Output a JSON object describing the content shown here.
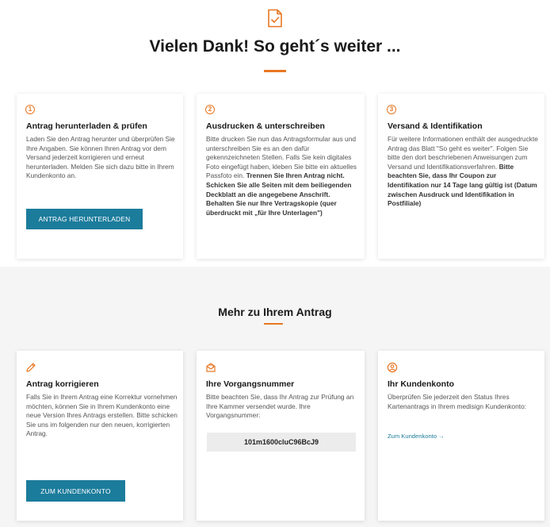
{
  "header": {
    "icon": "document-check-icon",
    "title": "Vielen Dank! So geht´s weiter ..."
  },
  "steps": [
    {
      "number": "1",
      "title": "Antrag herunterladen & prüfen",
      "text": "Laden Sie den Antrag herunter und überprüfen Sie Ihre Angaben. Sie können Ihren Antrag vor dem Versand jederzeit korrigieren und erneut herunterladen. Melden Sie sich dazu bitte in Ihrem Kundenkonto an.",
      "button": "ANTRAG HERUNTERLADEN"
    },
    {
      "number": "2",
      "title": "Ausdrucken & unterschreiben",
      "text": "Bitte drucken Sie nun das Antragsformular aus und unterschreiben Sie es an den dafür gekennzeichneten Stellen. Falls Sie kein digitales Foto eingefügt haben, kleben Sie bitte ein aktuelles Passfoto ein.",
      "bold": "Trennen Sie Ihren Antrag nicht. Schicken Sie alle Seiten mit dem beiliegenden Deckblatt an die angegebene Anschrift. Behalten Sie nur Ihre Vertragskopie (quer überdruckt mit „für Ihre Unterlagen\")"
    },
    {
      "number": "3",
      "title": "Versand & Identifikation",
      "text": "Für weitere Informationen enthält der ausgedruckte Antrag das Blatt \"So geht es weiter\". Folgen Sie bitte den dort beschriebenen Anweisungen zum Versand und Identifikationsverfahren.",
      "bold": "Bitte beachten Sie, dass Ihr Coupon zur Identifikation nur 14 Tage lang gültig ist (Datum zwischen Ausdruck und Identifikation in Postfiliale)"
    }
  ],
  "more": {
    "title": "Mehr zu Ihrem Antrag",
    "cards": [
      {
        "icon": "pencil-icon",
        "title": "Antrag korrigieren",
        "text": "Falls Sie in Ihrem Antrag eine Korrektur vornehmen möchten, können Sie in Ihrem Kundenkonto eine neue Version Ihres Antrags erstellen. Bitte schicken Sie uns im folgenden nur den neuen, korrigierten Antrag.",
        "button": "ZUM KUNDENKONTO"
      },
      {
        "icon": "envelope-icon",
        "title": "Ihre Vorgangsnummer",
        "text": "Bitte beachten Sie, dass Ihr Antrag zur Prüfung an Ihre Kammer versendet wurde. Ihre Vorgangsnummer:",
        "code": "101m1600cluC96BcJ9"
      },
      {
        "icon": "user-circle-icon",
        "title": "Ihr Kundenkonto",
        "text": "Überprüfen Sie jederzeit den Status Ihres Kartenantrags in Ihrem medisign Kundenkonto:",
        "link": "Zum Kundenkonto →"
      }
    ]
  },
  "colors": {
    "accent": "#e87722",
    "button": "#1c7c9c"
  }
}
